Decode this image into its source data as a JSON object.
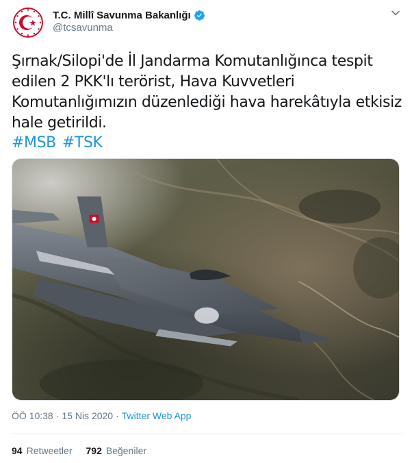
{
  "tweet": {
    "author": {
      "display_name": "T.C. Millî Savunma Bakanlığı",
      "handle": "@tcsavunma",
      "avatar_icon": "crescent-star-emblem-icon",
      "verified_icon": "verified-badge-icon"
    },
    "more_icon": "chevron-down-icon",
    "text_lines": [
      "Şırnak/Silopi'de İl Jandarma Komutanlığınca tespit",
      "edilen 2 PKK'lı terörist, Hava Kuvvetleri",
      "Komutanlığımızın düzenlediği hava harekâtıyla etkisiz",
      "hale getirildi."
    ],
    "hashtags": [
      "#MSB",
      "#TSK"
    ],
    "media": {
      "type": "photo",
      "alt_icon": "fighter-jet-photo"
    },
    "meta": {
      "time": "ÖÖ 10:38",
      "separator": "·",
      "date": "15 Nis 2020",
      "source": "Twitter Web App"
    },
    "stats": {
      "retweets_count": "94",
      "retweets_label": "Retweetler",
      "likes_count": "792",
      "likes_label": "Beğeniler"
    }
  },
  "colors": {
    "link": "#1b95e0",
    "text": "#14171a",
    "secondary": "#657786",
    "brand_red": "#c8102e"
  }
}
